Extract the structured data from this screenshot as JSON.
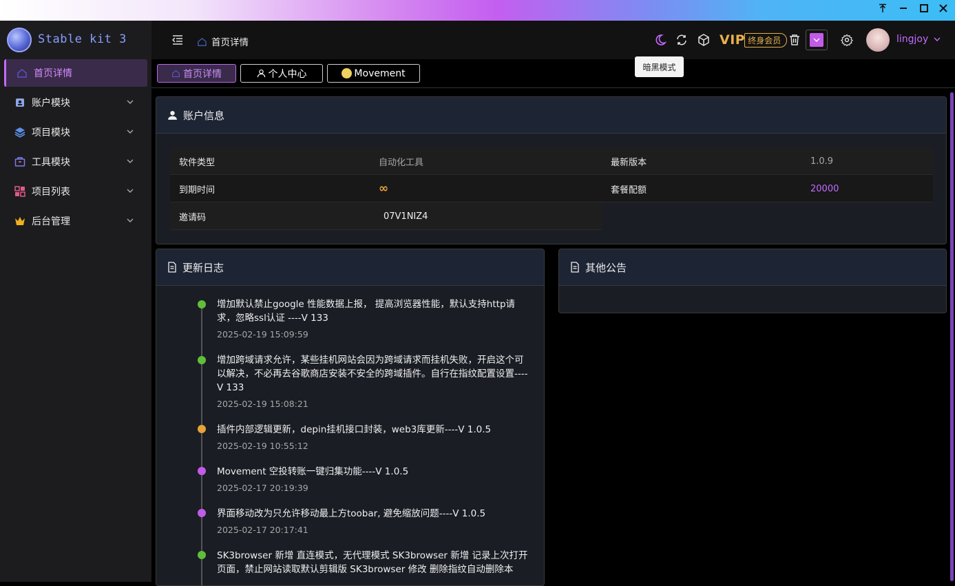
{
  "window": {
    "pin_icon": "pin-icon",
    "min_icon": "minimize-icon",
    "max_icon": "maximize-icon",
    "close_icon": "close-icon"
  },
  "brand": {
    "name": "Stable kit 3"
  },
  "sidebar": {
    "items": [
      {
        "label": "首页详情",
        "icon": "home-icon",
        "active": true
      },
      {
        "label": "账户模块",
        "icon": "account-icon"
      },
      {
        "label": "项目模块",
        "icon": "layers-icon"
      },
      {
        "label": "工具模块",
        "icon": "toolbox-icon"
      },
      {
        "label": "项目列表",
        "icon": "grid-icon"
      },
      {
        "label": "后台管理",
        "icon": "crown-icon"
      }
    ]
  },
  "topbar": {
    "breadcrumb": "首页详情",
    "vip_text": "VIP",
    "vip_badge": "终身会员",
    "username": "lingjoy",
    "tooltip": "暗黑模式"
  },
  "tabs": [
    {
      "label": "首页详情",
      "active": true
    },
    {
      "label": "个人中心"
    },
    {
      "label": "Movement"
    }
  ],
  "account": {
    "title": "账户信息",
    "rows": [
      {
        "k1": "软件类型",
        "v1": "自动化工具",
        "k2": "最新版本",
        "v2": "1.0.9"
      },
      {
        "k1": "到期时间",
        "v1": "∞",
        "k2": "套餐配额",
        "v2": "20000"
      },
      {
        "k1": "邀请码",
        "v1": "07V1NIZ4"
      }
    ]
  },
  "changelog": {
    "title": "更新日志",
    "entries": [
      {
        "text": "增加默认禁止google 性能数据上报， 提高浏览器性能，默认支持http请求，忽略ssl认证 ----V 133",
        "time": "2025-02-19 15:09:59",
        "color": "#5fbf3a"
      },
      {
        "text": "增加跨域请求允许，某些挂机网站会因为跨域请求而挂机失败，开启这个可以解决，不必再去谷歌商店安装不安全的跨域插件。自行在指纹配置设置----V 133",
        "time": "2025-02-19 15:08:21",
        "color": "#5fbf3a"
      },
      {
        "text": "插件内部逻辑更新，depin挂机接口封装，web3库更新----V 1.0.5",
        "time": "2025-02-19 10:55:12",
        "color": "#e8a23a"
      },
      {
        "text": "Movement 空投转账一键归集功能----V 1.0.5",
        "time": "2025-02-17 20:19:39",
        "color": "#c25be8"
      },
      {
        "text": "界面移动改为只允许移动最上方toobar, 避免缩放问题----V 1.0.5",
        "time": "2025-02-17 20:17:41",
        "color": "#c25be8"
      },
      {
        "text": "SK3browser 新增 直连模式，无代理模式 SK3browser 新增 记录上次打开页面，禁止网站读取默认剪辑版 SK3browser 修改 删除指纹自动删除本",
        "time": "",
        "color": "#5fbf3a"
      }
    ]
  },
  "announcements": {
    "title": "其他公告"
  }
}
